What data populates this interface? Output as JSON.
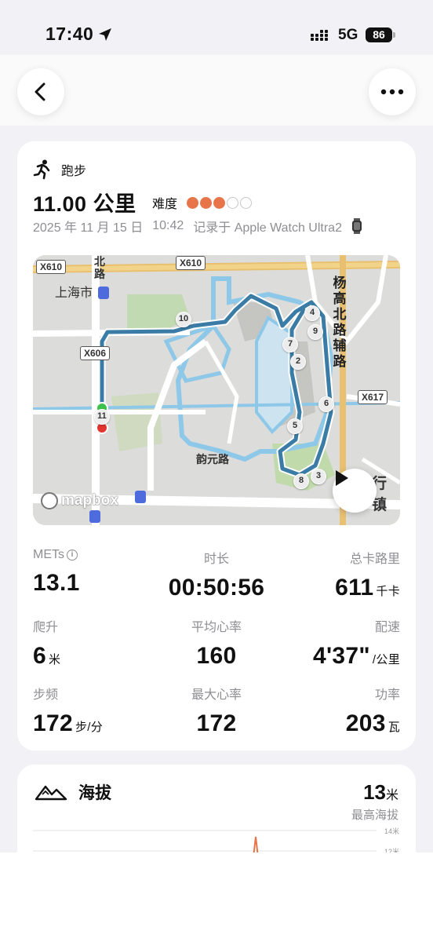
{
  "status_bar": {
    "time": "17:40",
    "network": "5G",
    "battery": "86"
  },
  "activity": {
    "type": "跑步",
    "distance": "11.00 公里",
    "difficulty_label": "难度",
    "difficulty_level": 3,
    "difficulty_max": 5,
    "date": "2025 年 11 月 15 日",
    "time": "10:42",
    "recorded_by": "记录于 Apple Watch Ultra2"
  },
  "map": {
    "labels": {
      "district": "上海市",
      "road_north": "北路",
      "road_yuanyuan": "韵元路",
      "road_yanggao": "杨高北路辅路",
      "partial_town": "行镇",
      "mapbox": "mapbox"
    },
    "road_shields": [
      "X610",
      "X610",
      "X606",
      "X617"
    ],
    "km_markers": [
      "2",
      "3",
      "4",
      "5",
      "6",
      "7",
      "8",
      "9",
      "10",
      "11"
    ]
  },
  "stats": {
    "mets": {
      "label": "METs",
      "value": "13.1"
    },
    "duration": {
      "label": "时长",
      "value": "00:50:56"
    },
    "calories": {
      "label": "总卡路里",
      "value": "611",
      "unit": "千卡"
    },
    "climb": {
      "label": "爬升",
      "value": "6",
      "unit": "米"
    },
    "avg_hr": {
      "label": "平均心率",
      "value": "160"
    },
    "pace": {
      "label": "配速",
      "value": "4'37\"",
      "unit": "/公里"
    },
    "cadence": {
      "label": "步频",
      "value": "172",
      "unit": "步/分"
    },
    "max_hr": {
      "label": "最大心率",
      "value": "172"
    },
    "power": {
      "label": "功率",
      "value": "203",
      "unit": "瓦"
    }
  },
  "altitude": {
    "title": "海拔",
    "max_value": "13",
    "max_unit": "米",
    "max_label": "最高海拔",
    "ticks": [
      "14米",
      "12米"
    ]
  },
  "colors": {
    "accent": "#e8754a",
    "route": "#3a7ca5",
    "water": "#8ec8e8",
    "park": "#bcd9a6"
  }
}
